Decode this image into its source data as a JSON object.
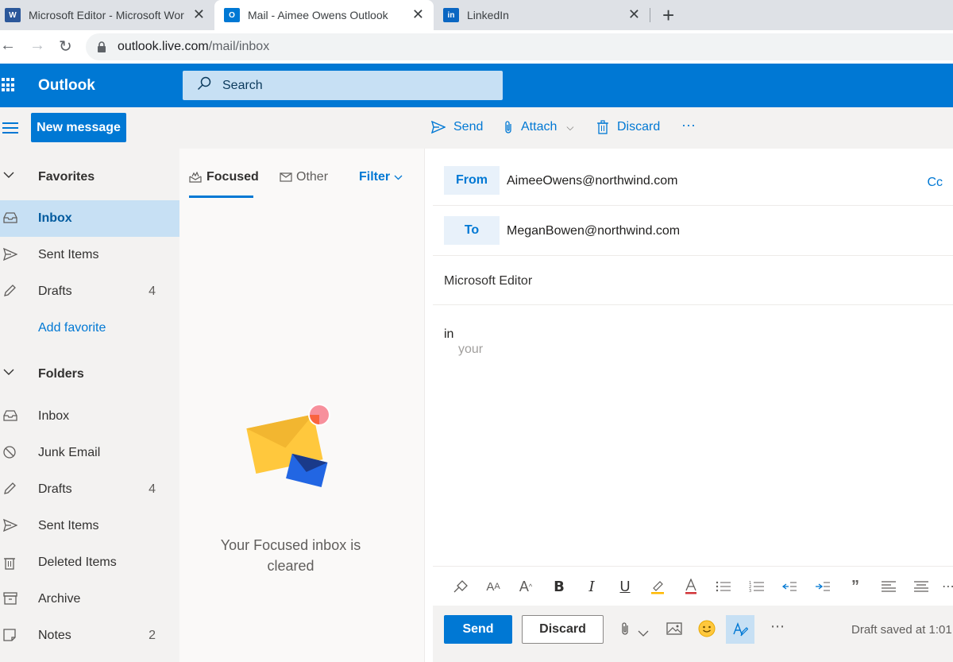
{
  "browser": {
    "tabs": [
      {
        "title": "Microsoft Editor - Microsoft Wor",
        "favicon": "word-icon",
        "active": false
      },
      {
        "title": "Mail - Aimee Owens  Outlook",
        "favicon": "outlook-icon",
        "active": true
      },
      {
        "title": "LinkedIn",
        "favicon": "linkedin-icon",
        "active": false
      }
    ],
    "url_domain": "outlook.live.com",
    "url_path": "/mail/inbox"
  },
  "header": {
    "app_name": "Outlook",
    "search_placeholder": "Search"
  },
  "commandbar": {
    "new_message": "New message",
    "send": "Send",
    "attach": "Attach",
    "discard": "Discard",
    "more": "···"
  },
  "nav": {
    "favorites_label": "Favorites",
    "favorites": [
      {
        "label": "Inbox",
        "count": "",
        "icon": "inbox-icon",
        "selected": true
      },
      {
        "label": "Sent Items",
        "count": "",
        "icon": "send-icon"
      },
      {
        "label": "Drafts",
        "count": "4",
        "icon": "pencil-icon"
      }
    ],
    "add_favorite": "Add favorite",
    "folders_label": "Folders",
    "folders": [
      {
        "label": "Inbox",
        "count": "",
        "icon": "inbox-icon"
      },
      {
        "label": "Junk Email",
        "count": "",
        "icon": "block-icon"
      },
      {
        "label": "Drafts",
        "count": "4",
        "icon": "pencil-icon"
      },
      {
        "label": "Sent Items",
        "count": "",
        "icon": "send-icon"
      },
      {
        "label": "Deleted Items",
        "count": "",
        "icon": "trash-icon"
      },
      {
        "label": "Archive",
        "count": "",
        "icon": "archive-icon"
      },
      {
        "label": "Notes",
        "count": "2",
        "icon": "note-icon"
      }
    ]
  },
  "messagelist": {
    "tab_focused": "Focused",
    "tab_other": "Other",
    "filter": "Filter",
    "empty_line1": "Your Focused inbox is",
    "empty_line2": "cleared"
  },
  "compose": {
    "from_label": "From",
    "from_value": "AimeeOwens@northwind.com",
    "to_label": "To",
    "to_value": "MeganBowen@northwind.com",
    "cc_label": "Cc",
    "subject": "Microsoft Editor",
    "body": "in",
    "suggestion": "your",
    "send_label": "Send",
    "discard_label": "Discard",
    "draft_status": "Draft saved at 1:01"
  },
  "colors": {
    "brand": "#0078d4",
    "selected_bg": "#c7e0f4"
  }
}
